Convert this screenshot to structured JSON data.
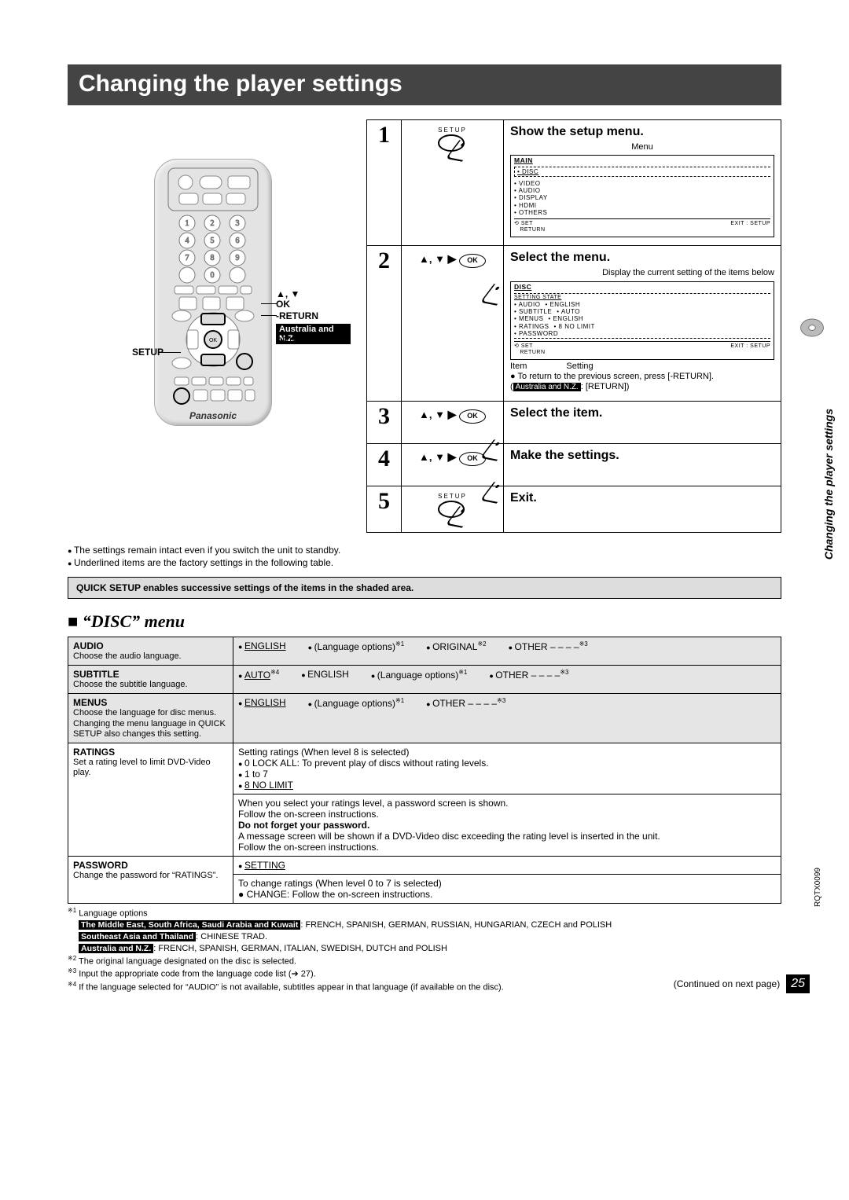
{
  "title": "Changing the player settings",
  "side_label": "Changing the player settings",
  "doc_code": "RQTX0099",
  "page_num": "25",
  "continued": "(Continued on next page)",
  "remote": {
    "brand": "Panasonic",
    "labels": {
      "arrows": "▲, ▼\nOK",
      "return": "-RETURN",
      "aust": "Australia and N.Z.",
      "return2": "RETURN",
      "setup": "SETUP"
    }
  },
  "steps": [
    {
      "n": "1",
      "icon_label": "SETUP",
      "title": "Show the setup menu.",
      "osd_title": "Menu",
      "osd": {
        "head": "MAIN",
        "items": [
          "DISC",
          "VIDEO",
          "AUDIO",
          "DISPLAY",
          "HDMI",
          "OTHERS"
        ],
        "selected": 0,
        "foot_left": "⟲ RETURN",
        "foot_set": "SET",
        "foot_right": "EXIT : SETUP"
      }
    },
    {
      "n": "2",
      "icon_label": "▲, ▼ ▶ OK",
      "title": "Select the menu.",
      "note_above_osd": "Display the current setting of the items below",
      "osd": {
        "head": "DISC",
        "sub": "SETTING STATE",
        "rows": [
          [
            "AUDIO",
            "ENGLISH"
          ],
          [
            "SUBTITLE",
            "AUTO"
          ],
          [
            "MENUS",
            "ENGLISH"
          ],
          [
            "RATINGS",
            "8 NO LIMIT"
          ],
          [
            "PASSWORD",
            ""
          ]
        ],
        "foot_left": "⟲ RETURN",
        "foot_set": "SET",
        "foot_right": "EXIT : SETUP"
      },
      "below": {
        "item": "Item",
        "setting": "Setting",
        "bullets": [
          "To return to the previous screen, press [-RETURN]."
        ],
        "aus_note": ": [RETURN])"
      }
    },
    {
      "n": "3",
      "icon_label": "▲, ▼ ▶ OK",
      "title": "Select the item."
    },
    {
      "n": "4",
      "icon_label": "▲, ▼ ▶ OK",
      "title": "Make the settings."
    },
    {
      "n": "5",
      "icon_label": "SETUP",
      "title": "Exit."
    }
  ],
  "notes": [
    "The settings remain intact even if you switch the unit to standby.",
    "Underlined items are the factory settings in the following table."
  ],
  "quick": "QUICK SETUP enables successive settings of the items in the shaded area.",
  "disc_menu_title": "“DISC” menu",
  "disc_rows": [
    {
      "shaded": true,
      "title": "AUDIO",
      "desc": "Choose the audio language.",
      "opts": [
        {
          "t": "ENGLISH",
          "ul": true
        },
        {
          "t": "(Language options)",
          "sup": "※1"
        },
        {
          "t": "ORIGINAL",
          "sup": "※2"
        },
        {
          "t": "OTHER  – – – –",
          "sup": "※3"
        }
      ]
    },
    {
      "shaded": true,
      "title": "SUBTITLE",
      "desc": "Choose the subtitle language.",
      "opts": [
        {
          "t": "AUTO",
          "ul": true,
          "sup": "※4"
        },
        {
          "t": "ENGLISH"
        },
        {
          "t": "(Language options)",
          "sup": "※1"
        },
        {
          "t": "OTHER  – – – –",
          "sup": "※3"
        }
      ]
    },
    {
      "shaded": true,
      "title": "MENUS",
      "desc": "Choose the language for disc menus. Changing the menu language in QUICK SETUP also changes this setting.",
      "opts": [
        {
          "t": "ENGLISH",
          "ul": true
        },
        {
          "t": "(Language options)",
          "sup": "※1"
        },
        {
          "t": "OTHER  – – – –",
          "sup": "※3"
        }
      ]
    },
    {
      "title": "RATINGS",
      "desc": "Set a rating level to limit DVD-Video play.",
      "body_top": "Setting ratings (When level 8 is selected)",
      "body_bullets": [
        "0 LOCK ALL: To prevent play of discs without rating levels.",
        "1 to 7",
        "8 NO LIMIT"
      ],
      "body_ul_index": 2,
      "body_bottom": [
        "When you select your ratings level, a password screen is shown.",
        "Follow the on-screen instructions.",
        "Do not forget your password.",
        "A message screen will be shown if a DVD-Video disc exceeding the rating level is inserted in the unit.",
        "Follow the on-screen instructions."
      ],
      "body_bottom_bold_index": 2
    },
    {
      "title": "PASSWORD",
      "desc": "Change the password for “RATINGS”.",
      "opts": [
        {
          "t": "SETTING",
          "ul": true
        }
      ],
      "after": [
        "To change ratings (When level 0 to 7 is selected)",
        "● CHANGE: Follow the on-screen instructions."
      ]
    }
  ],
  "footnotes": [
    {
      "tag": "※1",
      "text": "Language options"
    },
    {
      "tag": "",
      "prefix": "The Middle East, South Africa, Saudi Arabia and Kuwait",
      "text": ": FRENCH, SPANISH, GERMAN, RUSSIAN, HUNGARIAN, CZECH and POLISH"
    },
    {
      "tag": "",
      "prefix": "Southeast Asia and Thailand",
      "text": ": CHINESE TRAD."
    },
    {
      "tag": "",
      "prefix": "Australia and N.Z.",
      "text": ": FRENCH, SPANISH, GERMAN, ITALIAN, SWEDISH, DUTCH and POLISH"
    },
    {
      "tag": "※2",
      "text": "The original language designated on the disc is selected."
    },
    {
      "tag": "※3",
      "text": "Input the appropriate code from the language code list (➔ 27)."
    },
    {
      "tag": "※4",
      "text": "If the language selected for “AUDIO” is not available, subtitles appear in that language (if available on the disc)."
    }
  ]
}
